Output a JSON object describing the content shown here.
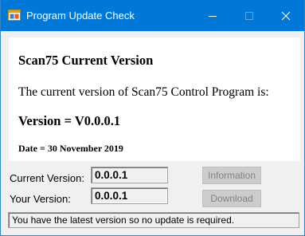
{
  "window": {
    "title": "Program Update Check",
    "accent_color": "#0078d7",
    "icon": "app-window-icon"
  },
  "title_buttons": {
    "minimize": "minimize-icon",
    "maximize": "maximize-icon",
    "close": "close-icon"
  },
  "info": {
    "heading": "Scan75 Current Version",
    "current_text": "The current version of Scan75 Control Program is:",
    "version_text": "Version = V0.0.0.1",
    "date_text": "Date = 30 November 2019"
  },
  "fields": {
    "current_label": "Current Version:",
    "current_value": "0.0.0.1",
    "your_label": "Your Version:",
    "your_value": "0.0.0.1"
  },
  "buttons": {
    "information_label": "Information",
    "download_label": "Download",
    "disabled": true
  },
  "status": {
    "text": "You have the latest version so no update is required."
  }
}
